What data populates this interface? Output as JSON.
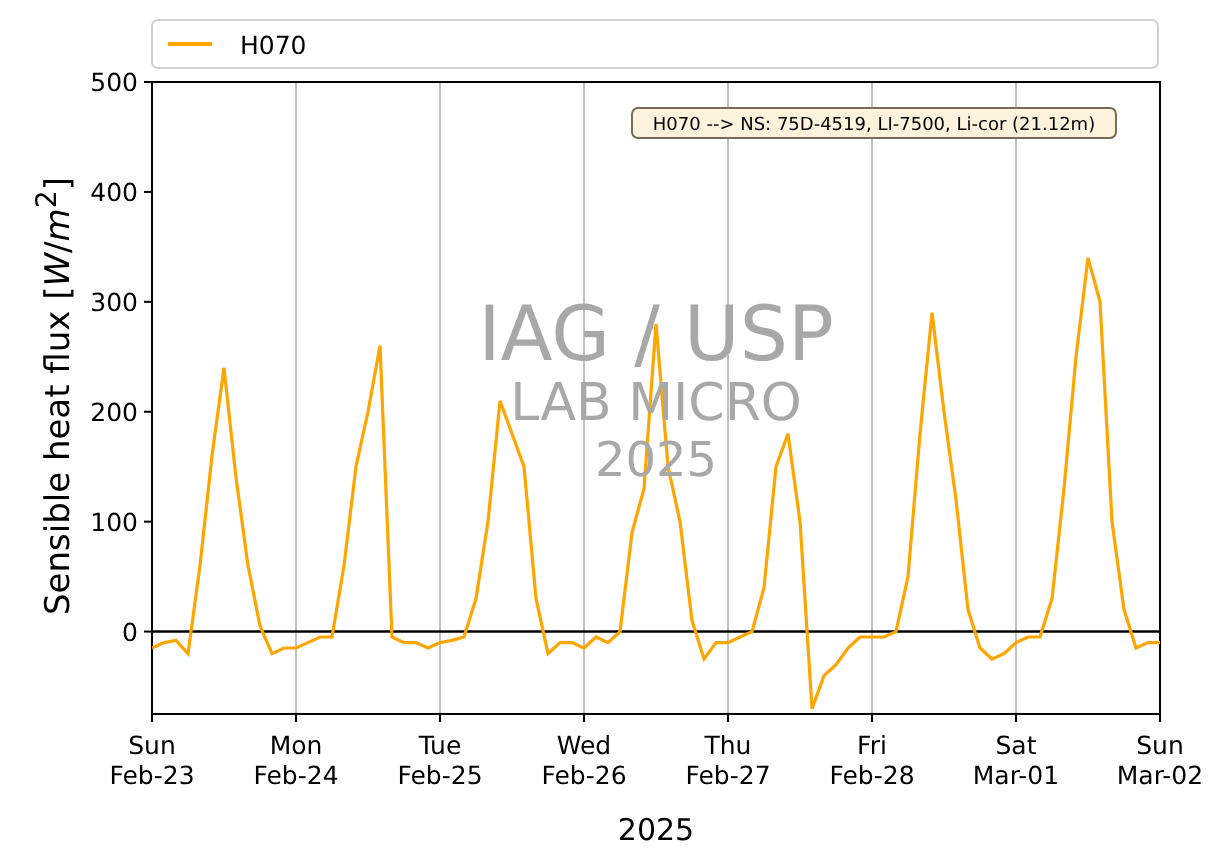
{
  "figure": {
    "chart_data": {
      "type": "line",
      "xlabel": "2025",
      "ylabel": "Sensible heat flux [*W*/*m*$^{2}$]",
      "categories": [
        "Sun Feb-23",
        null,
        null,
        null,
        null,
        null,
        null,
        null,
        null,
        null,
        null,
        null,
        "Mon Feb-24",
        null,
        null,
        null,
        null,
        null,
        null,
        null,
        null,
        null,
        null,
        null,
        "Tue Feb-25",
        null,
        null,
        null,
        null,
        null,
        null,
        null,
        null,
        null,
        null,
        null,
        "Wed Feb-26",
        null,
        null,
        null,
        null,
        null,
        null,
        null,
        null,
        null,
        null,
        null,
        "Thu Feb-27",
        null,
        null,
        null,
        null,
        null,
        null,
        null,
        null,
        null,
        null,
        null,
        "Fri Feb-28",
        null,
        null,
        null,
        null,
        null,
        null,
        null,
        null,
        null,
        null,
        null,
        "Sat Mar-01",
        null,
        null,
        null,
        null,
        null,
        null,
        null,
        null,
        null,
        null,
        null,
        "Sun Mar-02"
      ],
      "series": [
        {
          "name": "H070",
          "color": "#ffa500",
          "values": [
            -15,
            -10,
            -8,
            -20,
            60,
            160,
            240,
            140,
            60,
            5,
            -20,
            -15,
            -15,
            -10,
            -5,
            -5,
            60,
            150,
            200,
            260,
            -5,
            -10,
            -10,
            -15,
            -10,
            -8,
            -5,
            30,
            100,
            210,
            180,
            150,
            30,
            -20,
            -10,
            -10,
            -15,
            -5,
            -10,
            0,
            90,
            130,
            280,
            150,
            100,
            10,
            -25,
            -10,
            -10,
            -5,
            0,
            40,
            150,
            180,
            100,
            -70,
            -40,
            -30,
            -15,
            -5,
            -5,
            -5,
            0,
            50,
            180,
            290,
            200,
            120,
            20,
            -15,
            -25,
            -20,
            -10,
            -5,
            -5,
            30,
            130,
            250,
            340,
            300,
            100,
            20,
            -15,
            -10,
            -10
          ]
        }
      ],
      "grid": "x",
      "ylim": [
        -75,
        500
      ],
      "yticks": [
        0,
        100,
        200,
        300,
        400,
        500
      ],
      "annotations": [
        {
          "text": "H070 --> NS: 75D-4519, LI-7500, Li-cor (21.12m)"
        }
      ]
    },
    "watermark": [
      "IAG / USP",
      "LAB MICRO",
      "2025"
    ]
  }
}
